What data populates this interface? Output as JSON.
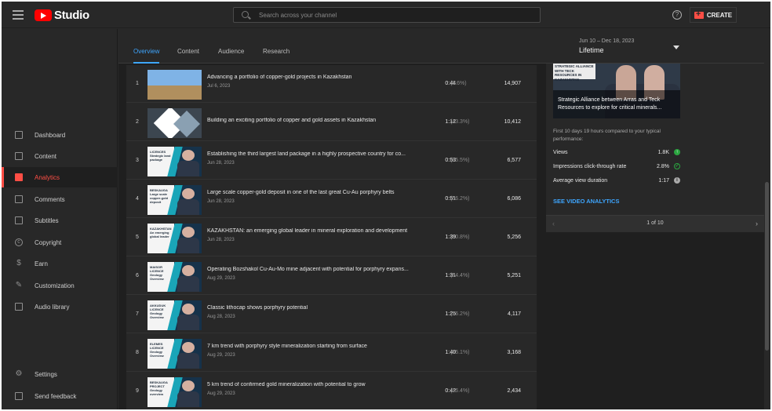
{
  "header": {
    "logo_text": "Studio",
    "search_placeholder": "Search across your channel",
    "help_icon": "?",
    "create_label": "CREATE"
  },
  "sidebar": {
    "items": [
      {
        "label": "Dashboard",
        "icon": "dashboard-icon",
        "active": false
      },
      {
        "label": "Content",
        "icon": "content-icon",
        "active": false
      },
      {
        "label": "Analytics",
        "icon": "analytics-icon",
        "active": true
      },
      {
        "label": "Comments",
        "icon": "comments-icon",
        "active": false
      },
      {
        "label": "Subtitles",
        "icon": "subtitles-icon",
        "active": false
      },
      {
        "label": "Copyright",
        "icon": "copyright-icon",
        "active": false
      },
      {
        "label": "Earn",
        "icon": "earn-icon",
        "active": false
      },
      {
        "label": "Customization",
        "icon": "customization-icon",
        "active": false
      },
      {
        "label": "Audio library",
        "icon": "audio-library-icon",
        "active": false
      }
    ],
    "bottom_items": [
      {
        "label": "Settings",
        "icon": "settings-icon"
      },
      {
        "label": "Send feedback",
        "icon": "feedback-icon"
      }
    ]
  },
  "tabs": [
    {
      "label": "Overview",
      "active": true
    },
    {
      "label": "Content",
      "active": false
    },
    {
      "label": "Audience",
      "active": false
    },
    {
      "label": "Research",
      "active": false
    }
  ],
  "date_filter": {
    "range": "Jun 10 – Dec 18, 2023",
    "value": "Lifetime"
  },
  "videos": [
    {
      "rank": "1",
      "title": "Advancing a portfolio of copper-gold projects in Kazakhstan",
      "date": "Jul 6, 2023",
      "avd": "0:44",
      "pct": "(9.6%)",
      "views": "14,907",
      "thumb_text": ""
    },
    {
      "rank": "2",
      "title": "Building an exciting portfolio of copper and gold assets in Kazakhstan",
      "date": "",
      "avd": "1:12",
      "pct": "(43.3%)",
      "views": "10,412",
      "thumb_text": ""
    },
    {
      "rank": "3",
      "title": "Establishing the third largest land package in a highly prospective country for co...",
      "date": "Jun 28, 2023",
      "avd": "0:53",
      "pct": "(95.5%)",
      "views": "6,577",
      "thumb_text": "LICENCES Strategic land package"
    },
    {
      "rank": "4",
      "title": "Large scale copper-gold deposit in one of the last great Cu-Au porphyry belts",
      "date": "Jun 28, 2023",
      "avd": "0:51",
      "pct": "(56.2%)",
      "views": "6,086",
      "thumb_text": "BESKAUGA Large scale copper-gold deposit"
    },
    {
      "rank": "5",
      "title": "KAZAKHSTAN: an emerging global leader in mineral exploration and development",
      "date": "Jun 28, 2023",
      "avd": "1:39",
      "pct": "(80.8%)",
      "views": "5,256",
      "thumb_text": "KAZAKHSTAN An emerging global leader"
    },
    {
      "rank": "6",
      "title": "Operating Bozshakol Cu-Au-Mo mine adjacent with potential for porphyry expans...",
      "date": "Aug 29, 2023",
      "avd": "1:31",
      "pct": "(84.4%)",
      "views": "5,251",
      "thumb_text": "MAISOR LICENCE Geology Overview"
    },
    {
      "rank": "7",
      "title": "Classic lithocap shows porphyry potential",
      "date": "Aug 28, 2023",
      "avd": "1:25",
      "pct": "(76.2%)",
      "views": "4,117",
      "thumb_text": "AKKUDUK LICENCE Geology Overview"
    },
    {
      "rank": "8",
      "title": "7 km trend with porphyry style mineralization starting from surface",
      "date": "Aug 29, 2023",
      "avd": "1:40",
      "pct": "(85.1%)",
      "views": "3,168",
      "thumb_text": "ELEMES LICENCE Geology Overview"
    },
    {
      "rank": "9",
      "title": "5 km trend of confirmed gold mineralization with potential to grow",
      "date": "Aug 29, 2023",
      "avd": "0:42",
      "pct": "(16.4%)",
      "views": "2,434",
      "thumb_text": "BESKAUGA PROJECT Geology overview"
    }
  ],
  "latest_card": {
    "preview_header": "STRATEGIC ALLIANCE WITH TECK RESOURCES IN KAZAKHSTAN",
    "preview_title": "Strategic Alliance between Arras and Teck Resources to explore for critical minerals...",
    "comparison": "First 10 days 19 hours compared to your typical performance:",
    "metrics": [
      {
        "label": "Views",
        "value": "1.8K",
        "icon": "arrow-up-icon"
      },
      {
        "label": "Impressions click-through rate",
        "value": "2.8%",
        "icon": "check-circle-icon"
      },
      {
        "label": "Average view duration",
        "value": "1:17",
        "icon": "info-icon"
      }
    ],
    "see_analytics": "SEE VIDEO ANALYTICS",
    "pager": "1 of 10"
  },
  "colors": {
    "accent_blue": "#3ea6ff",
    "accent_red": "#ff4e45",
    "status_green": "#2ba640"
  }
}
